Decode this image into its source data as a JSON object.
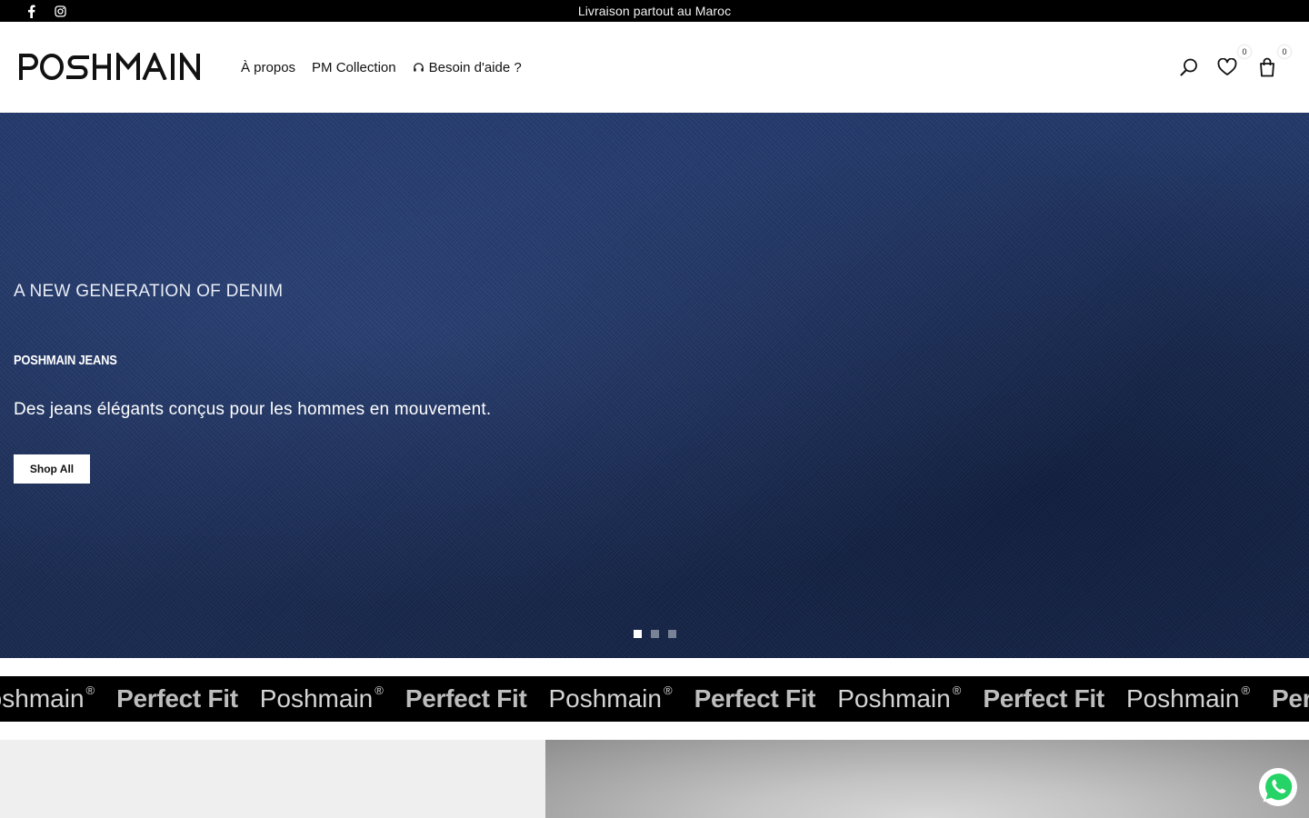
{
  "topbar": {
    "announcement": "Livraison partout au Maroc",
    "social": [
      "facebook-icon",
      "instagram-icon"
    ]
  },
  "header": {
    "logo_text": "POSHMAIN",
    "nav": [
      {
        "label": "À propos"
      },
      {
        "label": "PM Collection"
      },
      {
        "label": "Besoin d'aide ?",
        "icon": "headset-icon"
      }
    ],
    "wishlist_count": "0",
    "cart_count": "0"
  },
  "hero": {
    "eyebrow": "A NEW GENERATION OF DENIM",
    "brand": "POSHMAIN JEANS",
    "tagline": "Des jeans élégants conçus pour les hommes en mouvement.",
    "cta": "Shop All",
    "slides_total": 3,
    "active_slide": 1
  },
  "marquee": {
    "items": [
      {
        "text": "Poshmain",
        "mark": "®",
        "style": "regular"
      },
      {
        "text": "Perfect Fit",
        "style": "bold"
      },
      {
        "text": "Poshmain",
        "mark": "®",
        "style": "regular"
      },
      {
        "text": "Perfect Fit",
        "style": "bold"
      },
      {
        "text": "Poshmain",
        "mark": "®",
        "style": "regular"
      },
      {
        "text": "Perfect Fit",
        "style": "bold"
      },
      {
        "text": "Poshmain",
        "mark": "®",
        "style": "regular"
      },
      {
        "text": "Perfect Fit",
        "style": "bold"
      },
      {
        "text": "Poshmain",
        "mark": "®",
        "style": "regular"
      },
      {
        "text": "Perfect Fit",
        "style": "bold"
      }
    ]
  },
  "colors": {
    "topbar_bg": "#000000",
    "denim": "#1e3059",
    "whatsapp": "#25d366"
  }
}
